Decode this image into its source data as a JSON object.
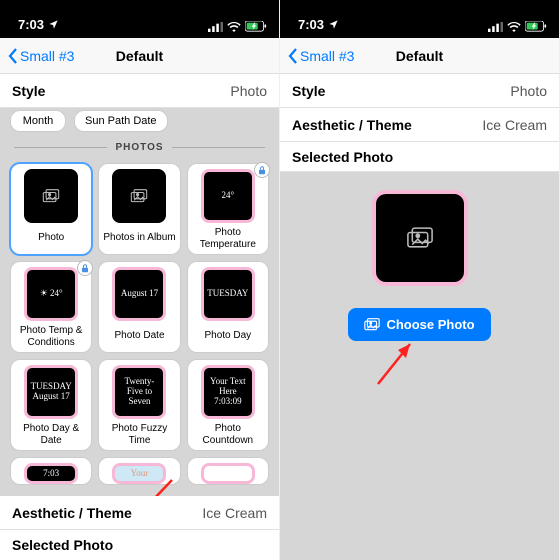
{
  "status": {
    "time": "7:03",
    "loc_arrow": "↗"
  },
  "nav": {
    "back": "Small #3",
    "title": "Default"
  },
  "rows": {
    "style_label": "Style",
    "style_value": "Photo",
    "aesthetic_label": "Aesthetic / Theme",
    "aesthetic_value": "Ice Cream",
    "selected_label": "Selected Photo"
  },
  "chips": {
    "month": "Month",
    "sunpath": "Sun Path Date"
  },
  "section": "PHOTOS",
  "cards": [
    {
      "label": "Photo",
      "thumb": ""
    },
    {
      "label": "Photos in Album",
      "thumb": ""
    },
    {
      "label": "Photo Temperature",
      "thumb": "24°"
    },
    {
      "label": "Photo Temp & Conditions",
      "thumb": "☀ 24°"
    },
    {
      "label": "Photo Date",
      "thumb": "August 17"
    },
    {
      "label": "Photo Day",
      "thumb": "TUESDAY"
    },
    {
      "label": "Photo Day & Date",
      "thumb": "TUESDAY August 17"
    },
    {
      "label": "Photo Fuzzy Time",
      "thumb": "Twenty-Five to Seven"
    },
    {
      "label": "Photo Countdown",
      "thumb": "Your Text Here 7:03:09"
    },
    {
      "label": "",
      "thumb": "7:03"
    },
    {
      "label": "",
      "thumb": "Your"
    }
  ],
  "choose_btn": "Choose Photo"
}
